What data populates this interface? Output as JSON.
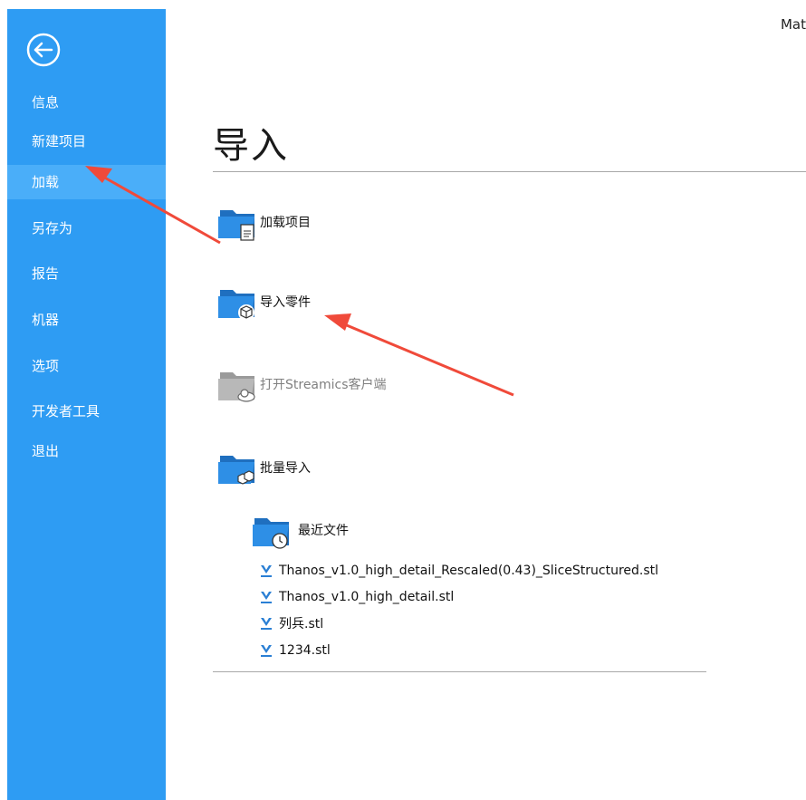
{
  "app_title": "Mat",
  "sidebar": {
    "items": [
      {
        "label": "信息"
      },
      {
        "label": "新建项目"
      },
      {
        "label": "加载",
        "active": true
      },
      {
        "label": "另存为"
      },
      {
        "label": "报告"
      },
      {
        "label": "机器"
      },
      {
        "label": "选项"
      },
      {
        "label": "开发者工具"
      },
      {
        "label": "退出"
      }
    ]
  },
  "page": {
    "title": "导入",
    "actions": [
      {
        "label": "加载项目",
        "icon": "folder-document-icon",
        "enabled": true
      },
      {
        "label": "导入零件",
        "icon": "folder-cube-icon",
        "enabled": true
      },
      {
        "label": "打开Streamics客户端",
        "icon": "folder-cloud-icon",
        "enabled": false
      },
      {
        "label": "批量导入",
        "icon": "folder-cubes-icon",
        "enabled": true
      }
    ],
    "recent": {
      "label": "最近文件",
      "files": [
        "Thanos_v1.0_high_detail_Rescaled(0.43)_SliceStructured.stl",
        "Thanos_v1.0_high_detail.stl",
        "列兵.stl",
        "1234.stl"
      ]
    }
  },
  "colors": {
    "sidebar": "#2e9cf3",
    "sidebar_active": "#4aaef9",
    "folder": "#2a7fd4",
    "annotation_arrow": "#f04a3a"
  }
}
